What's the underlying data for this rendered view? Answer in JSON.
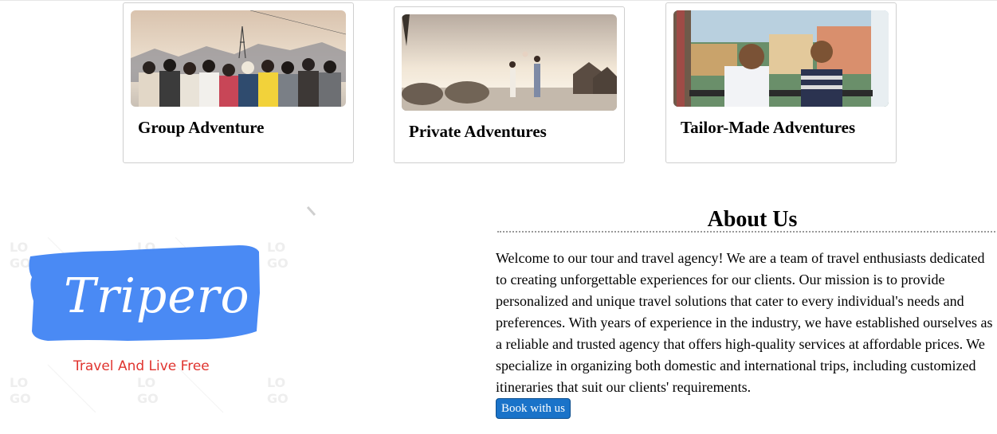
{
  "cards": [
    {
      "title": "Group Adventure",
      "image": "group-of-friends-photo"
    },
    {
      "title": "Private Adventures",
      "image": "couple-at-beach-photo"
    },
    {
      "title": "Tailor-Made Adventures",
      "image": "kids-at-window-photo"
    }
  ],
  "logo": {
    "brand": "Tripero",
    "tagline": "Travel And Live Free",
    "brand_color": "#4a8af4",
    "tagline_color": "#e0342f",
    "watermark": "LOGO"
  },
  "about": {
    "title": "About Us",
    "text": "Welcome to our tour and travel agency! We are a team of travel enthusiasts dedicated to creating unforgettable experiences for our clients. Our mission is to provide personalized and unique travel solutions that cater to every individual's needs and preferences. With years of experience in the industry, we have established ourselves as a reliable and trusted agency that offers high-quality services at affordable prices. We specialize in organizing both domestic and international trips, including customized itineraries that suit our clients' requirements.",
    "button_label": "Book with us",
    "button_color": "#1a73c9"
  }
}
